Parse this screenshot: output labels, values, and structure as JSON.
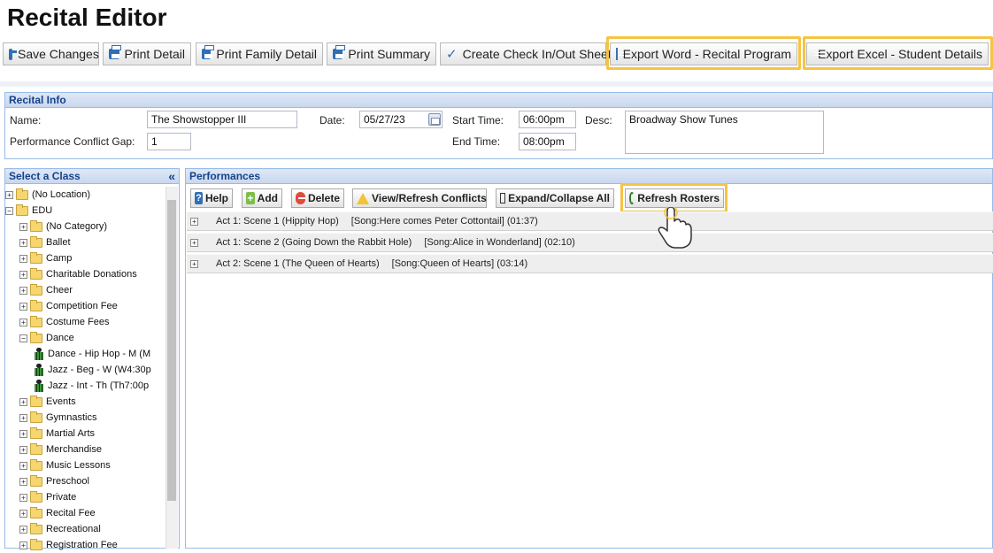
{
  "page": {
    "title": "Recital Editor"
  },
  "toolbar": {
    "save": "Save Changes",
    "print_detail": "Print Detail",
    "print_family": "Print Family Detail",
    "print_summary": "Print Summary",
    "checkin": "Create Check In/Out Sheet",
    "export_word": "Export Word - Recital Program",
    "export_excel": "Export Excel - Student Details"
  },
  "recital_info": {
    "header": "Recital Info",
    "name_label": "Name:",
    "name_value": "The Showstopper III",
    "date_label": "Date:",
    "date_value": "05/27/23",
    "start_label": "Start Time:",
    "start_value": "06:00pm",
    "end_label": "End Time:",
    "end_value": "08:00pm",
    "desc_label": "Desc:",
    "desc_value": "Broadway Show Tunes",
    "gap_label": "Performance Conflict Gap:",
    "gap_value": "1"
  },
  "class_tree": {
    "header": "Select a Class",
    "collapse_glyph": "«",
    "items": [
      {
        "label": "(No Location)",
        "level": 0,
        "expanded": false,
        "type": "folder"
      },
      {
        "label": "EDU",
        "level": 0,
        "expanded": true,
        "type": "folder"
      },
      {
        "label": "(No Category)",
        "level": 1,
        "expanded": false,
        "type": "folder"
      },
      {
        "label": "Ballet",
        "level": 1,
        "expanded": false,
        "type": "folder"
      },
      {
        "label": "Camp",
        "level": 1,
        "expanded": false,
        "type": "folder"
      },
      {
        "label": "Charitable Donations",
        "level": 1,
        "expanded": false,
        "type": "folder"
      },
      {
        "label": "Cheer",
        "level": 1,
        "expanded": false,
        "type": "folder"
      },
      {
        "label": "Competition Fee",
        "level": 1,
        "expanded": false,
        "type": "folder"
      },
      {
        "label": "Costume Fees",
        "level": 1,
        "expanded": false,
        "type": "folder"
      },
      {
        "label": "Dance",
        "level": 1,
        "expanded": true,
        "type": "folder"
      },
      {
        "label": "Dance - Hip Hop - M (M",
        "level": 2,
        "type": "class"
      },
      {
        "label": "Jazz - Beg - W (W4:30p",
        "level": 2,
        "type": "class"
      },
      {
        "label": "Jazz - Int - Th (Th7:00p",
        "level": 2,
        "type": "class"
      },
      {
        "label": "Events",
        "level": 1,
        "expanded": false,
        "type": "folder"
      },
      {
        "label": "Gymnastics",
        "level": 1,
        "expanded": false,
        "type": "folder"
      },
      {
        "label": "Martial Arts",
        "level": 1,
        "expanded": false,
        "type": "folder"
      },
      {
        "label": "Merchandise",
        "level": 1,
        "expanded": false,
        "type": "folder"
      },
      {
        "label": "Music Lessons",
        "level": 1,
        "expanded": false,
        "type": "folder"
      },
      {
        "label": "Preschool",
        "level": 1,
        "expanded": false,
        "type": "folder"
      },
      {
        "label": "Private",
        "level": 1,
        "expanded": false,
        "type": "folder"
      },
      {
        "label": "Recital Fee",
        "level": 1,
        "expanded": false,
        "type": "folder"
      },
      {
        "label": "Recreational",
        "level": 1,
        "expanded": false,
        "type": "folder"
      },
      {
        "label": "Registration Fee",
        "level": 1,
        "expanded": false,
        "type": "folder"
      }
    ]
  },
  "performances": {
    "header": "Performances",
    "buttons": {
      "help": "Help",
      "add": "Add",
      "delete": "Delete",
      "conflicts": "View/Refresh Conflicts",
      "expand": "Expand/Collapse All",
      "refresh": "Refresh Rosters"
    },
    "rows": [
      {
        "title": "Act 1: Scene 1 (Hippity Hop)",
        "song": "[Song:Here comes Peter Cottontail] (01:37)"
      },
      {
        "title": "Act 1: Scene 2 (Going Down the Rabbit Hole)",
        "song": "[Song:Alice in Wonderland] (02:10)"
      },
      {
        "title": "Act 2: Scene 1 (The Queen of Hearts)",
        "song": "[Song:Queen of Hearts] (03:14)"
      }
    ]
  },
  "colors": {
    "highlight": "#f6c343",
    "panel_header": "#15428b"
  }
}
